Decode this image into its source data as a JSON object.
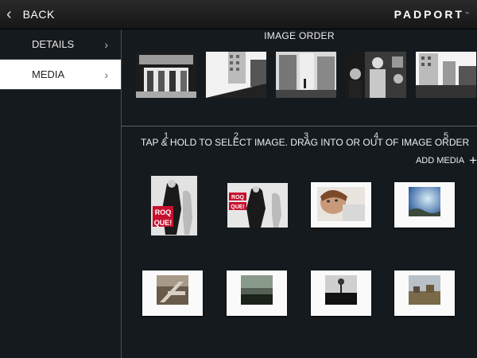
{
  "header": {
    "back_label": "BACK",
    "brand": "PADPORT",
    "brand_mark": "™"
  },
  "sidebar": {
    "items": [
      {
        "label": "DETAILS"
      },
      {
        "label": "MEDIA"
      }
    ]
  },
  "image_order": {
    "title": "IMAGE ORDER",
    "items": [
      {
        "number": "1"
      },
      {
        "number": "2"
      },
      {
        "number": "3"
      },
      {
        "number": "4"
      },
      {
        "number": "5"
      }
    ]
  },
  "media": {
    "instructions": "TAP & HOLD TO SELECT IMAGE. DRAG INTO OR OUT OF IMAGE ORDER",
    "add_label": "ADD MEDIA",
    "sign_text": [
      "ROQ",
      "QUE!"
    ]
  }
}
